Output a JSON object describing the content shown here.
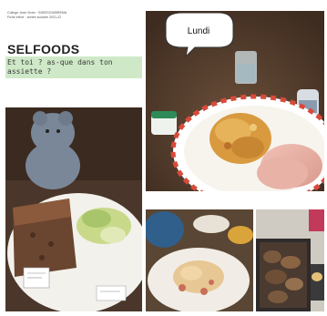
{
  "left_column": {
    "meta_line_1": "College Jean Vivier · INSEE/CM/BREMA",
    "meta_line_2": "Fiche élève · année scolaire 2021-22",
    "title": "SELFOODS",
    "question": "Et toi ? as-que dans ton assiette ?"
  },
  "top_right_photo": {
    "bubble_text": "Lundi"
  },
  "colors": {
    "band_green": "#cfe9c8",
    "plate_rim": "#d94a3a",
    "table_wood": "#5b4332"
  }
}
